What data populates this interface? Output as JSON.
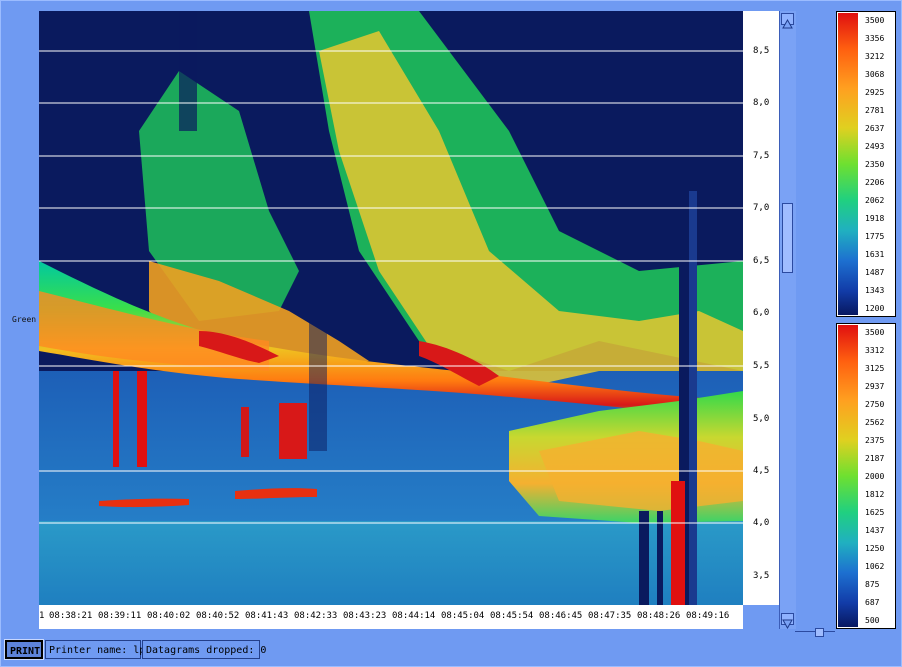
{
  "side_label": "Green",
  "x_axis": {
    "start_label": "1",
    "ticks": [
      "08:38:21",
      "08:39:11",
      "08:40:02",
      "08:40:52",
      "08:41:43",
      "08:42:33",
      "08:43:23",
      "08:44:14",
      "08:45:04",
      "08:45:54",
      "08:46:45",
      "08:47:35",
      "08:48:26",
      "08:49:16"
    ]
  },
  "y_axis": {
    "ticks": [
      "8,5",
      "8,0",
      "7,5",
      "7,0",
      "6,5",
      "6,0",
      "5,5",
      "5,0",
      "4,5",
      "4,0",
      "3,5"
    ]
  },
  "legend_top": {
    "labels": [
      "3500",
      "3356",
      "3212",
      "3068",
      "2925",
      "2781",
      "2637",
      "2493",
      "2350",
      "2206",
      "2062",
      "1918",
      "1775",
      "1631",
      "1487",
      "1343",
      "1200"
    ]
  },
  "legend_bottom": {
    "labels": [
      "3500",
      "3312",
      "3125",
      "2937",
      "2750",
      "2562",
      "2375",
      "2187",
      "2000",
      "1812",
      "1625",
      "1437",
      "1250",
      "1062",
      "875",
      "687",
      "500"
    ]
  },
  "status": {
    "print_label": "PRINT",
    "printer_name": "Printer name: lp",
    "datagrams_dropped": "Datagrams dropped: 0"
  },
  "colors": {
    "background": "#6f9af2",
    "plot_dark": "#0a1a5e",
    "gridline": "#ffffff"
  }
}
